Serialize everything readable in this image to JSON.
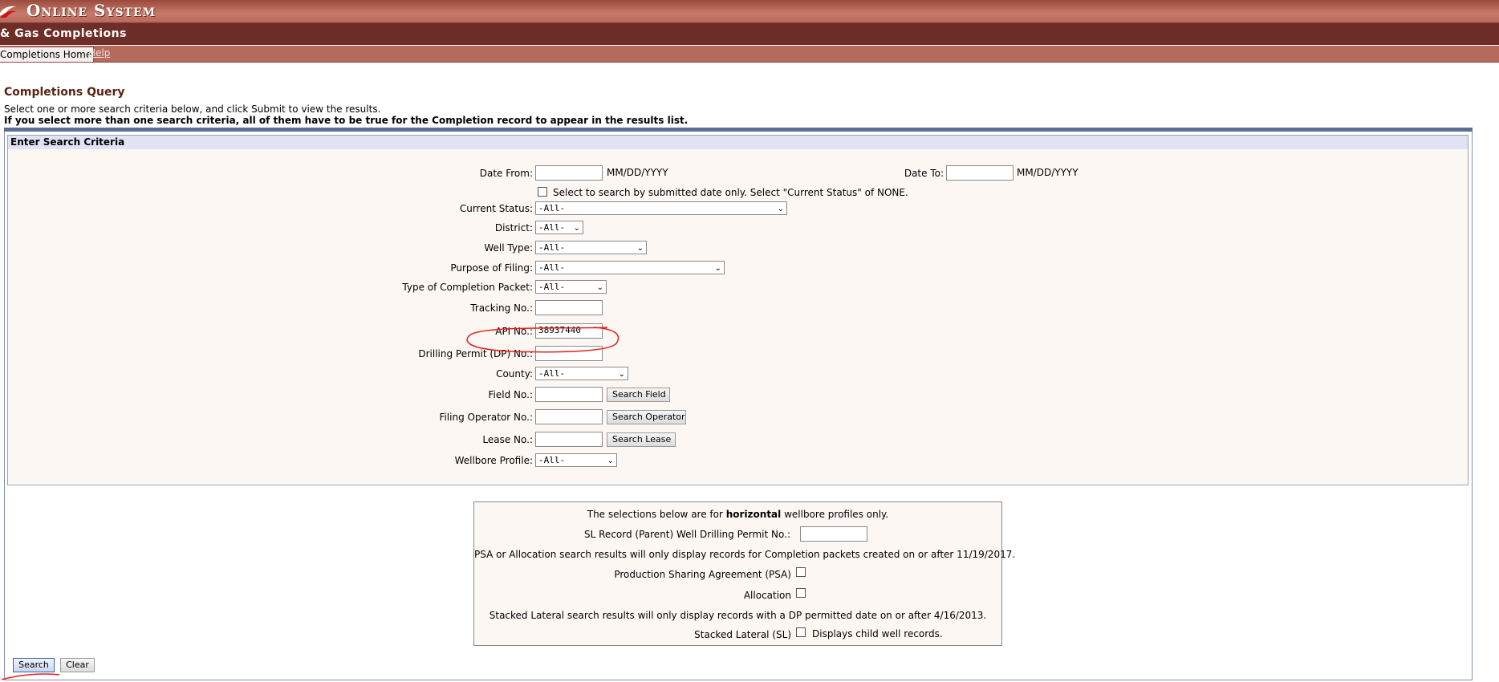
{
  "header": {
    "app_title": "Online System",
    "subtitle": "& Gas Completions"
  },
  "tabs": {
    "home": "Completions Home",
    "help": "Help"
  },
  "page": {
    "title": "Completions Query",
    "instructions": "Select one or more search criteria below, and click Submit to view the results.",
    "instructions_bold": "If you select more than one search criteria, all of them have to be true for the Completion record to appear in the results list."
  },
  "criteria": {
    "heading": "Enter Search Criteria",
    "date_from_label": "Date From:",
    "date_from_value": "",
    "date_format": "MM/DD/YYYY",
    "date_to_label": "Date To:",
    "date_to_value": "",
    "submitted_only_label": "Select to search by submitted date only. Select \"Current Status\" of NONE.",
    "current_status_label": "Current Status:",
    "current_status_value": "-All-",
    "district_label": "District:",
    "district_value": "-All-",
    "well_type_label": "Well Type:",
    "well_type_value": "-All-",
    "purpose_label": "Purpose of Filing:",
    "purpose_value": "-All-",
    "packet_type_label": "Type of Completion Packet:",
    "packet_type_value": "-All-",
    "tracking_label": "Tracking No.:",
    "tracking_value": "",
    "api_label": "API No.:",
    "api_value": "38937440",
    "dp_label": "Drilling Permit (DP) No.:",
    "dp_value": "",
    "county_label": "County:",
    "county_value": "-All-",
    "field_label": "Field No.:",
    "field_value": "",
    "field_button": "Search Field",
    "operator_label": "Filing Operator No.:",
    "operator_value": "",
    "operator_button": "Search Operator",
    "lease_label": "Lease No.:",
    "lease_value": "",
    "lease_button": "Search Lease",
    "wellbore_label": "Wellbore Profile:",
    "wellbore_value": "-All-"
  },
  "horizontal": {
    "intro_pre": "The selections below are for ",
    "intro_bold": "horizontal",
    "intro_post": " wellbore profiles only.",
    "sl_parent_label": "SL Record (Parent) Well Drilling Permit No.:",
    "sl_parent_value": "",
    "psa_note": "PSA or Allocation search results will only display records for Completion packets created on or after 11/19/2017.",
    "psa_label": "Production Sharing Agreement (PSA)",
    "allocation_label": "Allocation",
    "stacked_note": "Stacked Lateral search results will only display records with a DP permitted date on or after 4/16/2013.",
    "stacked_label": "Stacked Lateral (SL)",
    "stacked_hint": "Displays child well records."
  },
  "actions": {
    "search": "Search",
    "clear": "Clear"
  },
  "colors": {
    "banner": "#b86a5b",
    "subbar": "#6e2d26",
    "title_brown": "#5a2410",
    "annotation_red": "#e0201a"
  }
}
